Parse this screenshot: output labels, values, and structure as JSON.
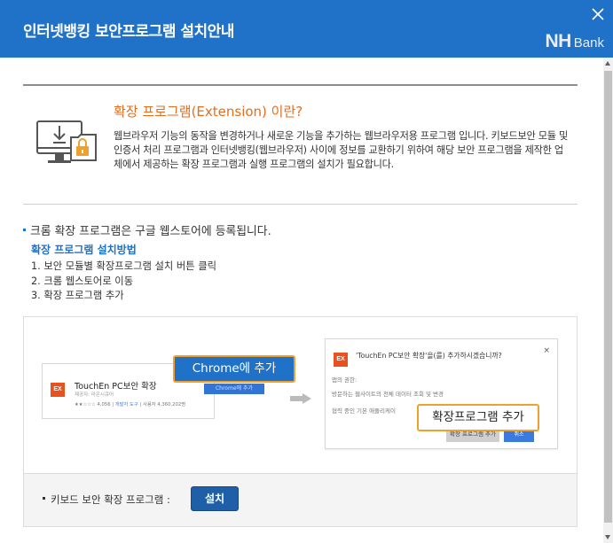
{
  "header": {
    "title": "인터넷뱅킹 보안프로그램 설치안내",
    "logo_nh": "NH",
    "logo_bank": "Bank"
  },
  "intro": {
    "heading": "확장 프로그램(Extension) 이란?",
    "text": "웹브라우저 기능의 동작을 변경하거나 새로운 기능을 추가하는 웹브라우저용 프로그램 입니다. 키보드보안 모듈 및 인증서 처리 프로그램과 인터넷뱅킹(웹브라우저) 사이에 정보를 교환하기 위하여 해당 보안 프로그램을 제작한 업체에서 제공하는 확장 프로그램과 실행 프로그램의 설치가 필요합니다."
  },
  "notice": "크롬 확장 프로그램은 구글 웹스토어에 등록됩니다.",
  "how_to": {
    "title": "확장 프로그램 설치방법",
    "steps": [
      "1. 보안 모듈별 확장프로그램 설치 버튼 클릭",
      "2. 크롬 웹스토어로 이동",
      "3. 확장 프로그램 추가"
    ]
  },
  "guide": {
    "ex_icon": "EX",
    "store_card": {
      "name": "TouchEn PC보안 확장",
      "publisher": "제공자: 라온시큐어",
      "rating": "★★☆☆☆ 4,056",
      "category": "개발자 도구",
      "users": "사용자 4,360,202명",
      "button": "Chrome에 추가"
    },
    "callout_chrome": "Chrome에 추가",
    "dialog": {
      "title": "'TouchEn PC보안 확장'을(를) 추가하시겠습니까?",
      "close": "×",
      "perm_label": "앱의 권한:",
      "perm_1": "방문하는 웹사이트의 전체 데이터 조회 및 변경",
      "perm_2": "협력 중인 기본 애플리케이",
      "add_button": "확장 프로그램 추가",
      "cancel_button": "취소"
    },
    "callout_install": "확장프로그램 추가"
  },
  "footer": {
    "label": "키보드 보안 확장 프로그램 :",
    "install_button": "설치"
  },
  "colors": {
    "header_bg": "#1f72c7",
    "accent_orange": "#e46e1e",
    "link_blue": "#1f72c7",
    "button_blue": "#1f5fa8"
  }
}
